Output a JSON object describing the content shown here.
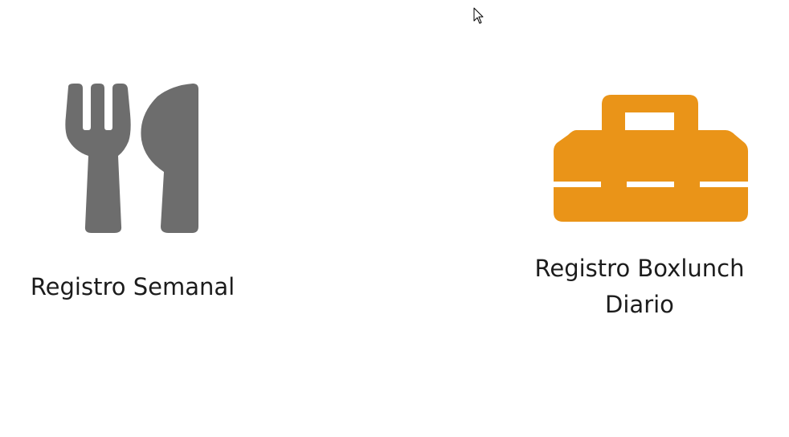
{
  "tiles": {
    "weekly": {
      "label": "Registro Semanal",
      "icon": "fork-knife-icon",
      "color": "#6d6d6d"
    },
    "boxlunch": {
      "label": "Registro Boxlunch Diario",
      "icon": "toolbox-icon",
      "color": "#ea9418"
    }
  },
  "cursor": {
    "icon": "mouse-pointer-icon"
  }
}
